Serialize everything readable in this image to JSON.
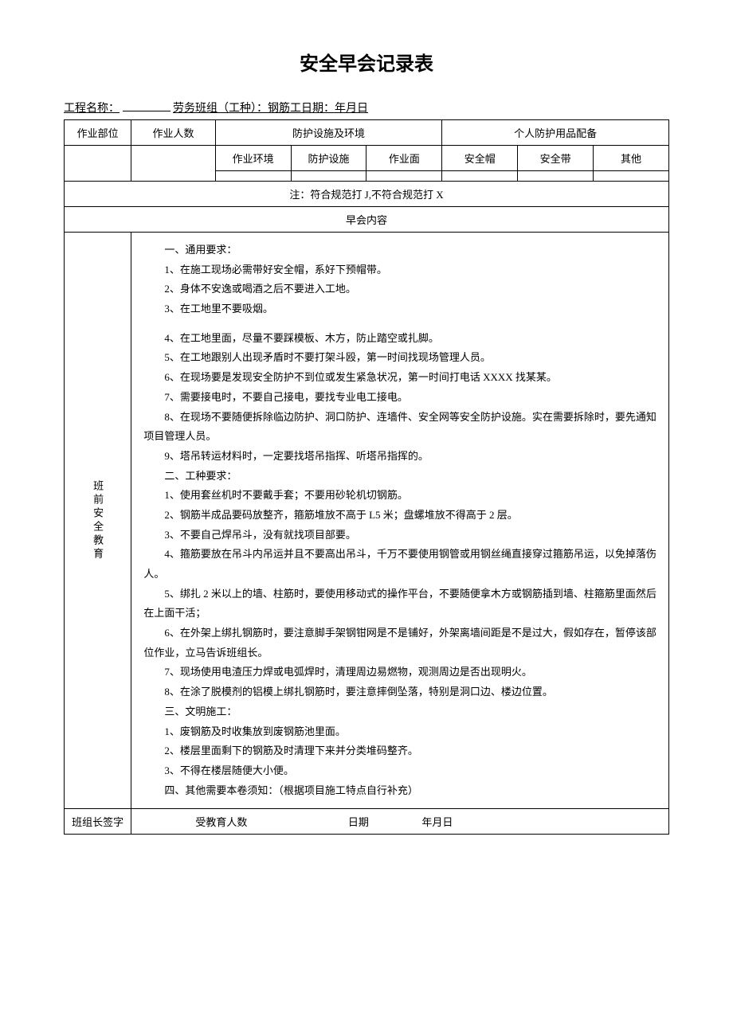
{
  "title": "安全早会记录表",
  "header": {
    "project_label": "工程名称：",
    "team_label": "劳务班组（工种）：钢筋工日期：年月日"
  },
  "table_headers": {
    "work_position": "作业部位",
    "work_count": "作业人数",
    "protection_env": "防护设施及环境",
    "ppe": "个人防护用品配备",
    "work_env": "作业环境",
    "protection_facility": "防护设施",
    "work_surface": "作业面",
    "helmet": "安全帽",
    "belt": "安全带",
    "other": "其他"
  },
  "note": "注：符合规范打 J,不符合规范打 X",
  "meeting_content_label": "早会内容",
  "education_label": "班前安全教育",
  "content": {
    "section1_title": "一、通用要求：",
    "item1_1": "1、在施工现场必需带好安全帽，系好下预帽带。",
    "item1_2": "2、身体不安逸或喝酒之后不要进入工地。",
    "item1_3": "3、在工地里不要吸烟。",
    "item1_4": "4、在工地里面，尽量不要踩模板、木方，防止踏空或扎脚。",
    "item1_5": "5、在工地跟别人出现矛盾时不要打架斗殴，第一时间找现场管理人员。",
    "item1_6": "6、在现场要是发现安全防护不到位或发生紧急状况，第一时间打电话 XXXX 找某某。",
    "item1_7": "7、需要接电时，不要自己接电，要找专业电工接电。",
    "item1_8": "8、在现场不要随便拆除临边防护、洞口防护、连墙件、安全网等安全防护设施。实在需要拆除时，要先通知项目管理人员。",
    "item1_9": "9、塔吊转运材料时，一定要找塔吊指挥、听塔吊指挥的。",
    "section2_title": "二、工种要求：",
    "item2_1": "1、使用套丝机时不要戴手套；不要用砂轮机切钢筋。",
    "item2_2": "2、钢筋半成品要码放整齐，箍筋堆放不高于 L5 米；盘螺堆放不得高于 2 层。",
    "item2_3": "3、不要自己焊吊斗，没有就找项目部要。",
    "item2_4": "4、箍筋要放在吊斗内吊运并且不要高出吊斗，千万不要使用钢管或用钢丝绳直接穿过箍筋吊运，以免掉落伤人。",
    "item2_5": "5、绑扎 2 米以上的墙、柱筋时，要使用移动式的操作平台，不要随便拿木方或钢筋插到墙、柱箍筋里面然后在上面干活；",
    "item2_6": "6、在外架上绑扎钢筋时，要注意脚手架钢钳网是不是铺好，外架离墙间距是不是过大，假如存在，暂停该部位作业，立马告诉班组长。",
    "item2_7": "7、现场使用电渣压力焊或电弧焊时，清理周边易燃物，观测周边是否出现明火。",
    "item2_8": "8、在涂了脱模剂的铝模上绑扎钢筋时，要注意摔倒坠落，特别是洞口边、楼边位置。",
    "section3_title": "三、文明施工：",
    "item3_1": "1、废钢筋及时收集放到废钢筋池里面。",
    "item3_2": "2、楼层里面剩下的钢筋及时清理下来并分类堆码整齐。",
    "item3_3": "3、不得在楼层随便大小便。",
    "section4_title": "四、其他需要本卷须知：（根据项目施工特点自行补充）"
  },
  "footer": {
    "leader_sign": "班组长签字",
    "educated_count": "受教育人数",
    "date_label": "日期",
    "date_value": "年月日"
  }
}
